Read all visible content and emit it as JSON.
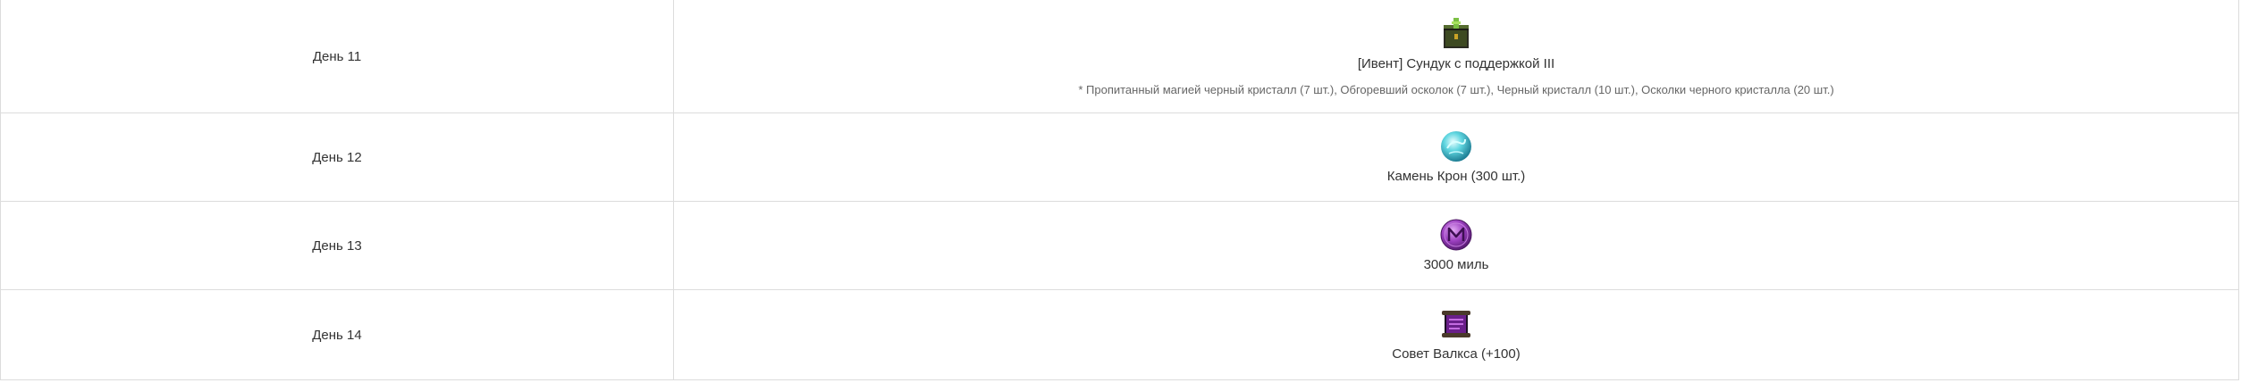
{
  "rows": [
    {
      "day": "День 11",
      "icon": "event-chest-icon",
      "reward": "[Ивент] Сундук с поддержкой III",
      "note": "* Пропитанный магией черный кристалл (7 шт.), Обгоревший осколок (7 шт.), Черный кристалл (10 шт.), Осколки черного кристалла (20 шт.)"
    },
    {
      "day": "День 12",
      "icon": "crown-stone-icon",
      "reward": "Камень Крон (300 шт.)"
    },
    {
      "day": "День 13",
      "icon": "mile-coin-icon",
      "reward": "3000 миль"
    },
    {
      "day": "День 14",
      "icon": "valks-scroll-icon",
      "reward": "Совет Валкса (+100)"
    }
  ],
  "colors": {
    "border": "#dcdcdc",
    "text": "#333333",
    "note_text": "#666666",
    "chest_green": "#7bc043",
    "crown_stone": "#5fd6e0",
    "mile_coin": "#9b3fbf",
    "scroll_purple": "#6a1f8a"
  }
}
